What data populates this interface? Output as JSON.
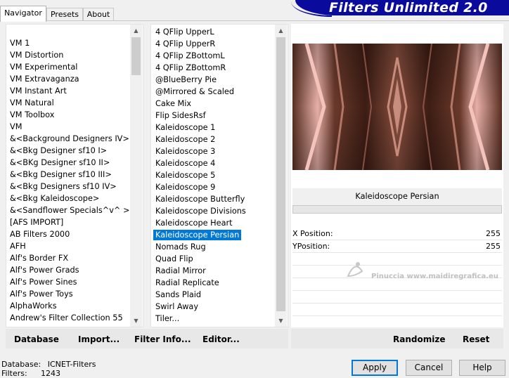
{
  "tabs": [
    "Navigator",
    "Presets",
    "About"
  ],
  "banner": "Filters Unlimited 2.0",
  "categories": [
    "VM 1",
    "VM Distortion",
    "VM Experimental",
    "VM Extravaganza",
    "VM Instant Art",
    "VM Natural",
    "VM Toolbox",
    "VM",
    "&<Background Designers IV>",
    "&<Bkg Designer sf10 I>",
    "&<BKg Designer sf10 II>",
    "&<Bkg Designer sf10 III>",
    "&<Bkg Designers sf10 IV>",
    "&<Bkg Kaleidoscope>",
    "&<Sandflower Specials^v^ >",
    "[AFS IMPORT]",
    "AB Filters 2000",
    "AFH",
    "Alf's Border FX",
    "Alf's Power Grads",
    "Alf's Power Sines",
    "Alf's Power Toys",
    "AlphaWorks",
    "Andrew's Filter Collection 55"
  ],
  "filters": [
    "4 QFlip UpperL",
    "4 QFlip UpperR",
    "4 QFlip ZBottomL",
    "4 QFlip ZBottomR",
    "@BlueBerry Pie",
    "@Mirrored & Scaled",
    "Cake Mix",
    "Flip SidesRsf",
    "Kaleidoscope 1",
    "Kaleidoscope 2",
    "Kaleidoscope 3",
    "Kaleidoscope 4",
    "Kaleidoscope 5",
    "Kaleidoscope 9",
    "Kaleidoscope Butterfly",
    "Kaleidoscope Divisions",
    "Kaleidoscope Heart",
    "Kaleidoscope Persian",
    "Nomads Rug",
    "Quad Flip",
    "Radial Mirror",
    "Radial Replicate",
    "Sands Plaid",
    "Swirl Away",
    "Tiler..."
  ],
  "selected_filter": "Kaleidoscope Persian",
  "filter_title": "Kaleidoscope Persian",
  "params": [
    {
      "label": "X Position:",
      "value": "255"
    },
    {
      "label": "YPosition:",
      "value": "255"
    }
  ],
  "watermark": "Pinuccia www.maidiregrafica.eu",
  "buttons": {
    "database": "Database",
    "import": "Import...",
    "filter_info": "Filter Info...",
    "editor": "Editor...",
    "randomize": "Randomize",
    "reset": "Reset",
    "apply": "Apply",
    "cancel": "Cancel",
    "help": "Help"
  },
  "status": {
    "database_label": "Database:",
    "database_value": "ICNET-Filters",
    "filters_label": "Filters:",
    "filters_value": "1243"
  }
}
